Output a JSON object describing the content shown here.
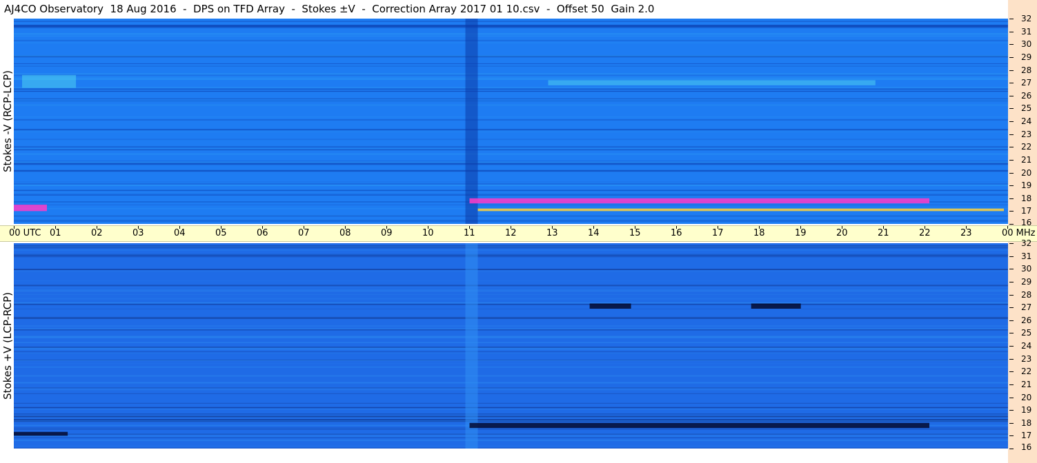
{
  "title": "AJ4CO Observatory  18 Aug 2016  -  DPS on TFD Array  -  Stokes ±V  -  Correction Array 2017 01 10.csv  -  Offset 50  Gain 2.0",
  "chart_data": [
    {
      "type": "heatmap",
      "panel": "top",
      "ylabel": "Stokes -V (RCP-LCP)",
      "x_ticks": [
        "00 UTC",
        "01",
        "02",
        "03",
        "04",
        "05",
        "06",
        "07",
        "08",
        "09",
        "10",
        "11",
        "12",
        "13",
        "14",
        "15",
        "16",
        "17",
        "18",
        "19",
        "20",
        "21",
        "22",
        "23",
        "00 MHz"
      ],
      "xlim": [
        0,
        24
      ],
      "y_ticks": [
        "32",
        "31",
        "30",
        "29",
        "28",
        "27",
        "26",
        "25",
        "24",
        "23",
        "22",
        "21",
        "20",
        "19",
        "18",
        "17",
        "16"
      ],
      "ylim": [
        16,
        32
      ],
      "y_unit": "MHz",
      "colors": {
        "background": "#1e7cf2",
        "light": "#2f9ff6",
        "dark": "#0b3aa8",
        "hot": "#ff3cc8",
        "warm": "#ffd23c",
        "cyan": "#56e0f0"
      },
      "features": [
        {
          "kind": "gap",
          "x": [
            10.9,
            11.2
          ],
          "description": "dark vertical band"
        },
        {
          "kind": "hot_band",
          "x": [
            0.0,
            0.8
          ],
          "y": [
            17.0,
            17.5
          ]
        },
        {
          "kind": "hot_band",
          "x": [
            11.0,
            22.1
          ],
          "y": [
            17.6,
            18.0
          ]
        },
        {
          "kind": "warm_line",
          "x": [
            11.2,
            23.9
          ],
          "y": [
            17.0,
            17.2
          ]
        },
        {
          "kind": "noise_patch",
          "x": [
            12.9,
            20.8
          ],
          "y": [
            26.8,
            27.2
          ]
        },
        {
          "kind": "noise_patch",
          "x": [
            0.2,
            1.5
          ],
          "y": [
            26.6,
            27.6
          ]
        }
      ]
    },
    {
      "type": "heatmap",
      "panel": "bottom",
      "ylabel": "Stokes +V (LCP-RCP)",
      "x_ticks": [
        "00 UTC",
        "01",
        "02",
        "03",
        "04",
        "05",
        "06",
        "07",
        "08",
        "09",
        "10",
        "11",
        "12",
        "13",
        "14",
        "15",
        "16",
        "17",
        "18",
        "19",
        "20",
        "21",
        "22",
        "23",
        "00 MHz"
      ],
      "xlim": [
        0,
        24
      ],
      "y_ticks": [
        "32",
        "31",
        "30",
        "29",
        "28",
        "27",
        "26",
        "25",
        "24",
        "23",
        "22",
        "21",
        "20",
        "19",
        "18",
        "17",
        "16"
      ],
      "ylim": [
        16,
        32
      ],
      "y_unit": "MHz",
      "colors": {
        "background": "#1f6be6",
        "light": "#2f8ef2",
        "dark": "#0a1f6a",
        "hot": "#050b30",
        "cyan": "#56e0f0"
      },
      "features": [
        {
          "kind": "gap",
          "x": [
            10.9,
            11.2
          ],
          "description": "light vertical band"
        },
        {
          "kind": "dark_band",
          "x": [
            0.0,
            1.3
          ],
          "y": [
            17.0,
            17.3
          ]
        },
        {
          "kind": "dark_band",
          "x": [
            11.0,
            22.1
          ],
          "y": [
            17.6,
            18.0
          ]
        },
        {
          "kind": "dark_patch",
          "x": [
            13.9,
            14.9
          ],
          "y": [
            26.9,
            27.3
          ]
        },
        {
          "kind": "dark_patch",
          "x": [
            17.8,
            19.0
          ],
          "y": [
            26.9,
            27.3
          ]
        }
      ]
    }
  ]
}
